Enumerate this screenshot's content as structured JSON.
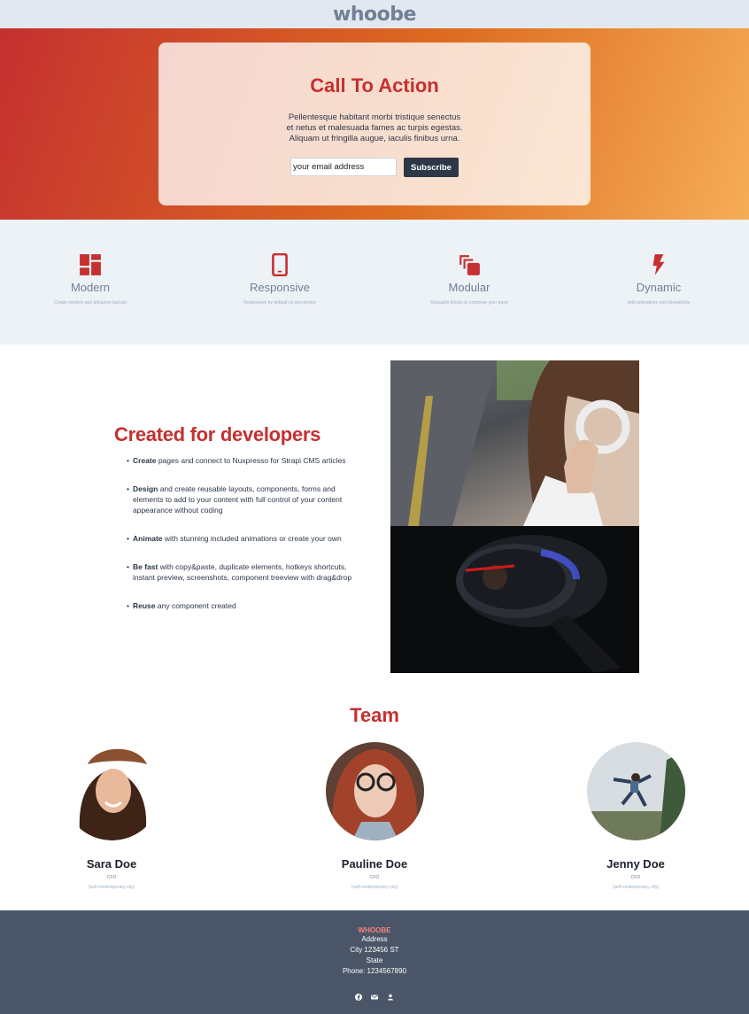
{
  "header": {
    "logo": "whoobe"
  },
  "hero": {
    "title": "Call To Action",
    "text": "Pellentesque habitant morbi tristique senectus et netus et malesuada fames ac turpis egestas. Aliquam ut fringilla augue, iaculis finibus urna.",
    "email_placeholder": "your email address",
    "subscribe_label": "Subscribe"
  },
  "features": [
    {
      "icon": "dashboard-icon",
      "title": "Modern",
      "desc": "Create modern and attractive layouts"
    },
    {
      "icon": "smartphone-icon",
      "title": "Responsive",
      "desc": "Responsive by default on any device"
    },
    {
      "icon": "layers-icon",
      "title": "Modular",
      "desc": "Reusable blocks to compose your page"
    },
    {
      "icon": "flash-icon",
      "title": "Dynamic",
      "desc": "Add animations and interactivity"
    }
  ],
  "developers": {
    "title": "Created for developers",
    "items": [
      {
        "bold": "Create",
        "text": " pages and connect to Nuxpresso for Strapi CMS articles"
      },
      {
        "bold": "Design",
        "text": " and create reusable layouts, components, forms and elements to add to your content with full control of your content appearance without coding"
      },
      {
        "bold": "Animate",
        "text": " with stunning included animations or create your own"
      },
      {
        "bold": "Be fast",
        "text": " with copy&paste, duplicate elements, hotkeys shortcuts, instant preview, screenshots, component treeview with drag&drop"
      },
      {
        "bold": "Reuse",
        "text": " any component created"
      }
    ]
  },
  "team": {
    "title": "Team",
    "members": [
      {
        "name": "Sara Doe",
        "role": "CFO",
        "tag": "(self-contemporary city)"
      },
      {
        "name": "Pauline Doe",
        "role": "CFO",
        "tag": "(self-contemporary city)"
      },
      {
        "name": "Jenny Doe",
        "role": "CFO",
        "tag": "(self-contemporary city)"
      }
    ]
  },
  "footer": {
    "brand": "WHOOBE",
    "address": "Address",
    "city": "City 123456 ST",
    "state": "State",
    "phone": "Phone: 1234567890",
    "social_icons": [
      "facebook-icon",
      "email-icon",
      "user-icon"
    ]
  },
  "colors": {
    "accent": "#c53030",
    "dark": "#2d3748",
    "footer_bg": "#4a5568",
    "light_bg": "#edf2f7"
  }
}
